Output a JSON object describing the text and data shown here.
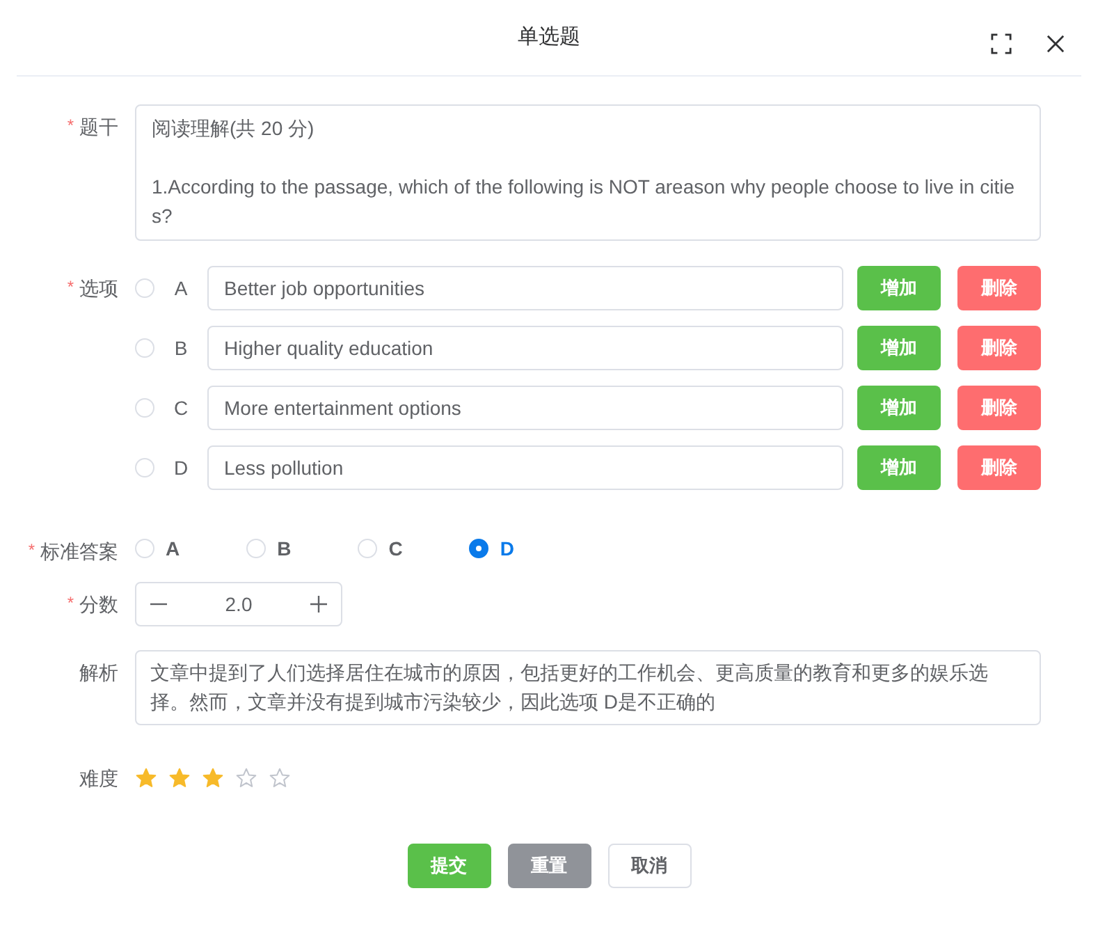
{
  "dialog": {
    "title": "单选题"
  },
  "stem": {
    "label": "题干",
    "required_mark": "*",
    "value": "阅读理解(共 20 分)\n\n1.According to the passage, which of the following is NOT areason why people choose to live in cities?"
  },
  "options": {
    "label": "选项",
    "required_mark": "*",
    "items": [
      {
        "letter": "A",
        "value": "Better job opportunities",
        "checked": false,
        "add_label": "增加",
        "delete_label": "删除"
      },
      {
        "letter": "B",
        "value": "Higher quality education",
        "checked": false,
        "add_label": "增加",
        "delete_label": "删除"
      },
      {
        "letter": "C",
        "value": "More entertainment options",
        "checked": false,
        "add_label": "增加",
        "delete_label": "删除"
      },
      {
        "letter": "D",
        "value": "Less pollution",
        "checked": false,
        "add_label": "增加",
        "delete_label": "删除"
      }
    ]
  },
  "answer": {
    "label": "标准答案",
    "required_mark": "*",
    "choices": [
      {
        "label": "A",
        "selected": false
      },
      {
        "label": "B",
        "selected": false
      },
      {
        "label": "C",
        "selected": false
      },
      {
        "label": "D",
        "selected": true
      }
    ]
  },
  "score": {
    "label": "分数",
    "required_mark": "*",
    "value": "2.0"
  },
  "analysis": {
    "label": "解析",
    "value": "文章中提到了人们选择居住在城市的原因，包括更好的工作机会、更高质量的教育和更多的娱乐选择。然而，文章并没有提到城市污染较少，因此选项 D是不正确的"
  },
  "difficulty": {
    "label": "难度",
    "stars": 3
  },
  "buttons": [
    {
      "label": "提交",
      "kind": "primary"
    },
    {
      "label": "重置",
      "kind": "secondary"
    },
    {
      "label": "取消",
      "kind": "plain"
    }
  ]
}
